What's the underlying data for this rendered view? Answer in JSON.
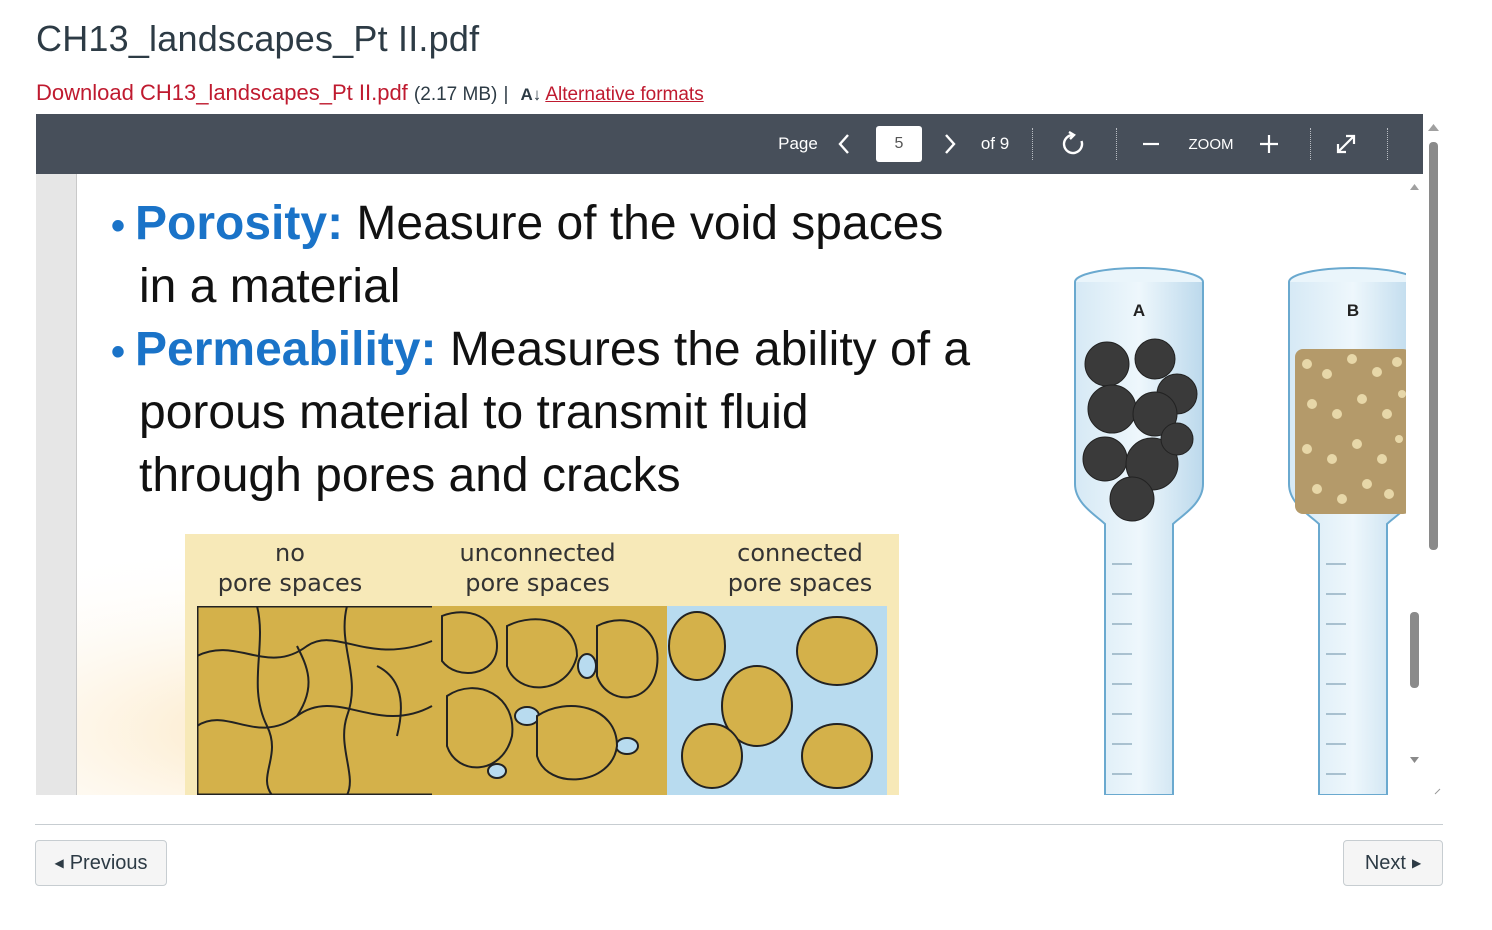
{
  "file": {
    "title": "CH13_landscapes_Pt II.pdf",
    "download_label": "Download CH13_landscapes_Pt II.pdf",
    "size": "(2.17 MB)",
    "separator": "|",
    "alt_formats_label": "Alternative formats"
  },
  "toolbar": {
    "page_label": "Page",
    "current_page": "5",
    "of_label": "of 9",
    "zoom_label": "ZOOM"
  },
  "slide": {
    "porosity_term": "Porosity:",
    "porosity_line1": "Measure of the void spaces",
    "porosity_line2": "in a material",
    "permeability_term": "Permeability:",
    "permeability_line1": "Measures the ability of a",
    "permeability_line2": "porous material to transmit fluid",
    "permeability_line3": "through pores and cracks",
    "diagram_labels": {
      "no_line1": "no",
      "no_line2": "pore spaces",
      "unconnected_line1": "unconnected",
      "unconnected_line2": "pore spaces",
      "connected_line1": "connected",
      "connected_line2": "pore spaces"
    },
    "tube_labels": {
      "a": "A",
      "b": "B"
    }
  },
  "nav": {
    "previous_label": "Previous",
    "next_label": "Next"
  },
  "icons": [
    "chevron-left-icon",
    "chevron-right-icon",
    "rotate-icon",
    "zoom-out-icon",
    "zoom-in-icon",
    "fullscreen-icon",
    "alt-formats-icon"
  ]
}
